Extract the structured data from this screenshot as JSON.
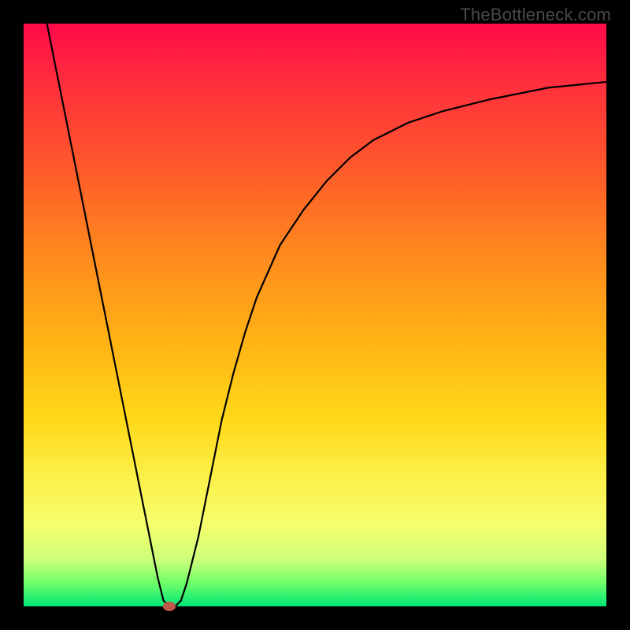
{
  "watermark": "TheBottleneck.com",
  "colors": {
    "frame": "#000000",
    "gradient_top": "#ff0a4a",
    "gradient_bottom": "#00e676",
    "curve": "#000000",
    "marker": "#c0584a"
  },
  "chart_data": {
    "type": "line",
    "title": "",
    "xlabel": "",
    "ylabel": "",
    "xlim": [
      0,
      100
    ],
    "ylim": [
      0,
      100
    ],
    "grid": false,
    "legend": false,
    "series": [
      {
        "name": "curve",
        "x": [
          4,
          6,
          8,
          10,
          12,
          14,
          16,
          18,
          20,
          22,
          23,
          24,
          25,
          26,
          27,
          28,
          30,
          32,
          34,
          36,
          38,
          40,
          44,
          48,
          52,
          56,
          60,
          66,
          72,
          80,
          90,
          100
        ],
        "y": [
          100,
          90,
          80,
          70,
          60,
          50,
          40,
          30,
          20,
          10,
          5,
          1,
          0,
          0,
          1,
          4,
          12,
          22,
          32,
          40,
          47,
          53,
          62,
          68,
          73,
          77,
          80,
          83,
          85,
          87,
          89,
          90
        ]
      }
    ],
    "marker": {
      "x": 25,
      "y": 0
    },
    "annotations": []
  }
}
